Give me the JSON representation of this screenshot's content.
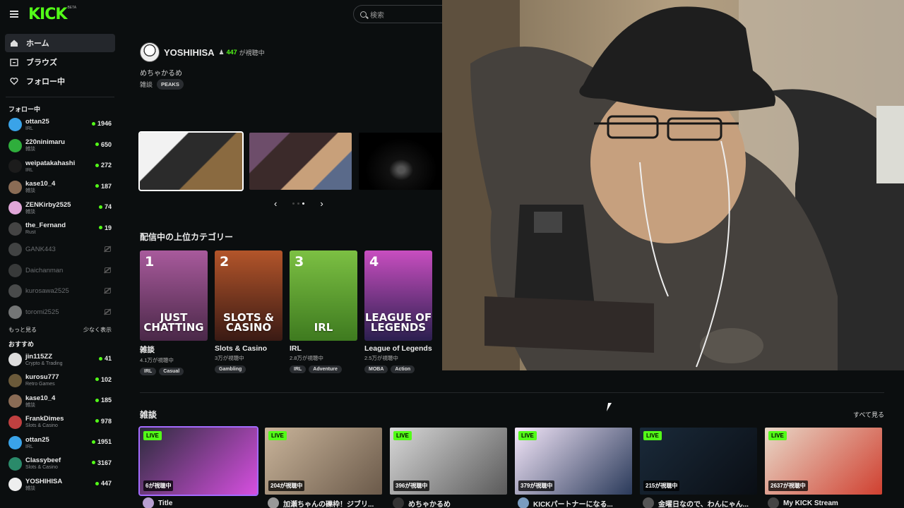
{
  "brand": {
    "logo": "KICK",
    "badge": "BETA"
  },
  "search": {
    "placeholder": "検索"
  },
  "nav": [
    {
      "label": "ホーム",
      "icon": "home-icon"
    },
    {
      "label": "ブラウズ",
      "icon": "browse-icon"
    },
    {
      "label": "フォロー中",
      "icon": "heart-icon"
    }
  ],
  "sidebar": {
    "following_title": "フォロー中",
    "following": [
      {
        "name": "ottan25",
        "category": "IRL",
        "viewers": "1946",
        "color": "#3aa3e8"
      },
      {
        "name": "220ninimaru",
        "category": "雑談",
        "viewers": "650",
        "color": "#2fae3c"
      },
      {
        "name": "weipatakahashi",
        "category": "IRL",
        "viewers": "272",
        "color": "#1c1c1c"
      },
      {
        "name": "kase10_4",
        "category": "雑談",
        "viewers": "187",
        "color": "#8a6c55"
      },
      {
        "name": "ZENKirby2525",
        "category": "雑談",
        "viewers": "74",
        "color": "#e0a6d8"
      },
      {
        "name": "the_Fernand",
        "category": "Rust",
        "viewers": "19",
        "color": "#444444"
      }
    ],
    "offline": [
      {
        "name": "GANK443",
        "color": "#777777"
      },
      {
        "name": "Daichanman",
        "color": "#666666"
      },
      {
        "name": "kurosawa2525",
        "color": "#888888"
      },
      {
        "name": "toromi2525",
        "color": "#dddddd"
      }
    ],
    "show_more": "もっと見る",
    "show_less": "少なく表示",
    "recommended_title": "おすすめ",
    "recommended": [
      {
        "name": "jin115ZZ",
        "category": "Crypto & Trading",
        "viewers": "41",
        "color": "#dddddd"
      },
      {
        "name": "kurosu777",
        "category": "Retro Games",
        "viewers": "102",
        "color": "#6b5a3a"
      },
      {
        "name": "kase10_4",
        "category": "雑談",
        "viewers": "185",
        "color": "#8a6c55"
      },
      {
        "name": "FrankDimes",
        "category": "Slots & Casino",
        "viewers": "978",
        "color": "#c04040"
      },
      {
        "name": "ottan25",
        "category": "IRL",
        "viewers": "1951",
        "color": "#3aa3e8"
      },
      {
        "name": "Classybeef",
        "category": "Slots & Casino",
        "viewers": "3167",
        "color": "#2a8a6a"
      },
      {
        "name": "YOSHIHISA",
        "category": "雑談",
        "viewers": "447",
        "color": "#eeeeee"
      }
    ]
  },
  "featured": {
    "name": "YOSHIHISA",
    "viewers": "447",
    "viewers_unit": "が視聴中",
    "title": "めちゃかるめ",
    "category": "雑談",
    "tag": "PEAKS"
  },
  "top_categories": {
    "title": "配信中の上位カテゴリー",
    "items": [
      {
        "rank": "1",
        "logo": "JUST CHATTING",
        "name": "雑談",
        "viewers": "4.1万が視聴中",
        "tags": [
          "IRL",
          "Casual"
        ],
        "colors": [
          "#a85a9c",
          "#4a2848"
        ]
      },
      {
        "rank": "2",
        "logo": "SLOTS & CASINO",
        "name": "Slots & Casino",
        "viewers": "3万が視聴中",
        "tags": [
          "Gambling"
        ],
        "colors": [
          "#b3552a",
          "#3a1a14"
        ]
      },
      {
        "rank": "3",
        "logo": "IRL",
        "name": "IRL",
        "viewers": "2.8万が視聴中",
        "tags": [
          "IRL",
          "Adventure"
        ],
        "colors": [
          "#7cc043",
          "#3e7a1f"
        ]
      },
      {
        "rank": "4",
        "logo": "LEAGUE OF LEGENDS",
        "name": "League of Legends",
        "viewers": "2.5万が視聴中",
        "tags": [
          "MOBA",
          "Action"
        ],
        "colors": [
          "#c84ec0",
          "#2b1f4f"
        ]
      }
    ]
  },
  "chat_section": {
    "title": "雑談",
    "see_all": "すべて見る",
    "live_label": "LIVE",
    "streams": [
      {
        "viewers": "6が視聴中",
        "title": "Title",
        "colors": [
          "#2c2c3c",
          "#d64fe0"
        ],
        "avatar": "#b89fd0"
      },
      {
        "viewers": "204が視聴中",
        "title": "加瀬ちゃんの礫枠！ジブリ...",
        "colors": [
          "#c9b49a",
          "#6b5a4a"
        ],
        "avatar": "#999999"
      },
      {
        "viewers": "396が視聴中",
        "title": "めちゃかるめ",
        "colors": [
          "#d8d8d8",
          "#5a5a5a"
        ],
        "avatar": "#333333"
      },
      {
        "viewers": "379が視聴中",
        "title": "KICKパートナーになる...",
        "colors": [
          "#f3e6f9",
          "#2a3a5a"
        ],
        "avatar": "#7a9cc0"
      },
      {
        "viewers": "215が視聴中",
        "title": "金曜日なので、わんにゃん...",
        "colors": [
          "#1a2a3a",
          "#0a0e14"
        ],
        "avatar": "#555555"
      },
      {
        "viewers": "2637が視聴中",
        "title": "My KICK Stream",
        "colors": [
          "#e8d8c8",
          "#d04030"
        ],
        "avatar": "#444444"
      }
    ]
  }
}
